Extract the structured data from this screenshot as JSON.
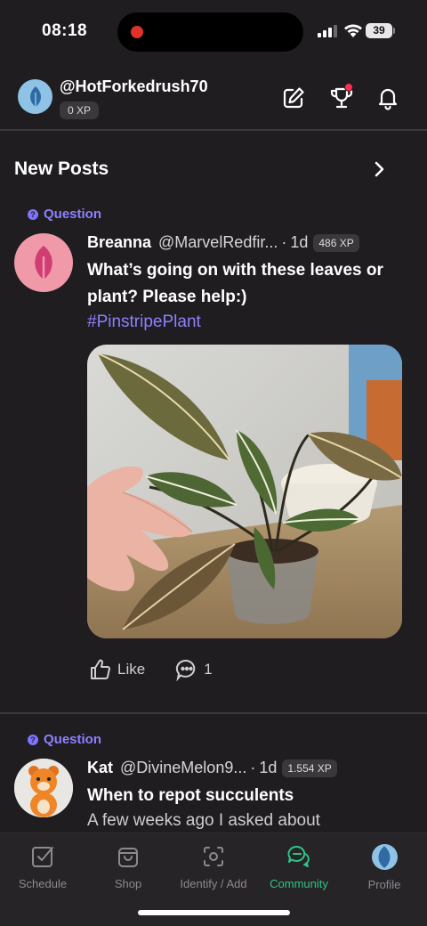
{
  "status_bar": {
    "time": "08:18",
    "battery": "39"
  },
  "header": {
    "username": "@HotForkedrush70",
    "xp": "0 XP"
  },
  "section": {
    "title": "New Posts"
  },
  "posts": [
    {
      "tag": "Question",
      "author": "Breanna",
      "handle": "@MarvelRedfir...",
      "dot": "·",
      "age": "1d",
      "xp": "486 XP",
      "title": "What’s going on with these leaves or plant? Please help:)",
      "hashtag": "#PinstripePlant",
      "like_label": "Like",
      "comment_count": "1"
    },
    {
      "tag": "Question",
      "author": "Kat",
      "handle": "@DivineMelon9...",
      "dot": "·",
      "age": "1d",
      "xp": "1.554 XP",
      "title": "When to repot succulents",
      "snippet": "A few weeks ago I asked about"
    }
  ],
  "tabbar": {
    "items": [
      {
        "label": "Schedule",
        "icon": "checkbox-icon"
      },
      {
        "label": "Shop",
        "icon": "shopping-bag-icon"
      },
      {
        "label": "Identify / Add",
        "icon": "scan-icon"
      },
      {
        "label": "Community",
        "icon": "chat-bubbles-icon",
        "active": true
      },
      {
        "label": "Profile",
        "icon": "avatar-icon"
      }
    ]
  },
  "colors": {
    "accent_purple": "#8d80ff",
    "accent_green": "#2ec486",
    "background": "#1f1d20",
    "notification_dot": "#ff2d55"
  }
}
